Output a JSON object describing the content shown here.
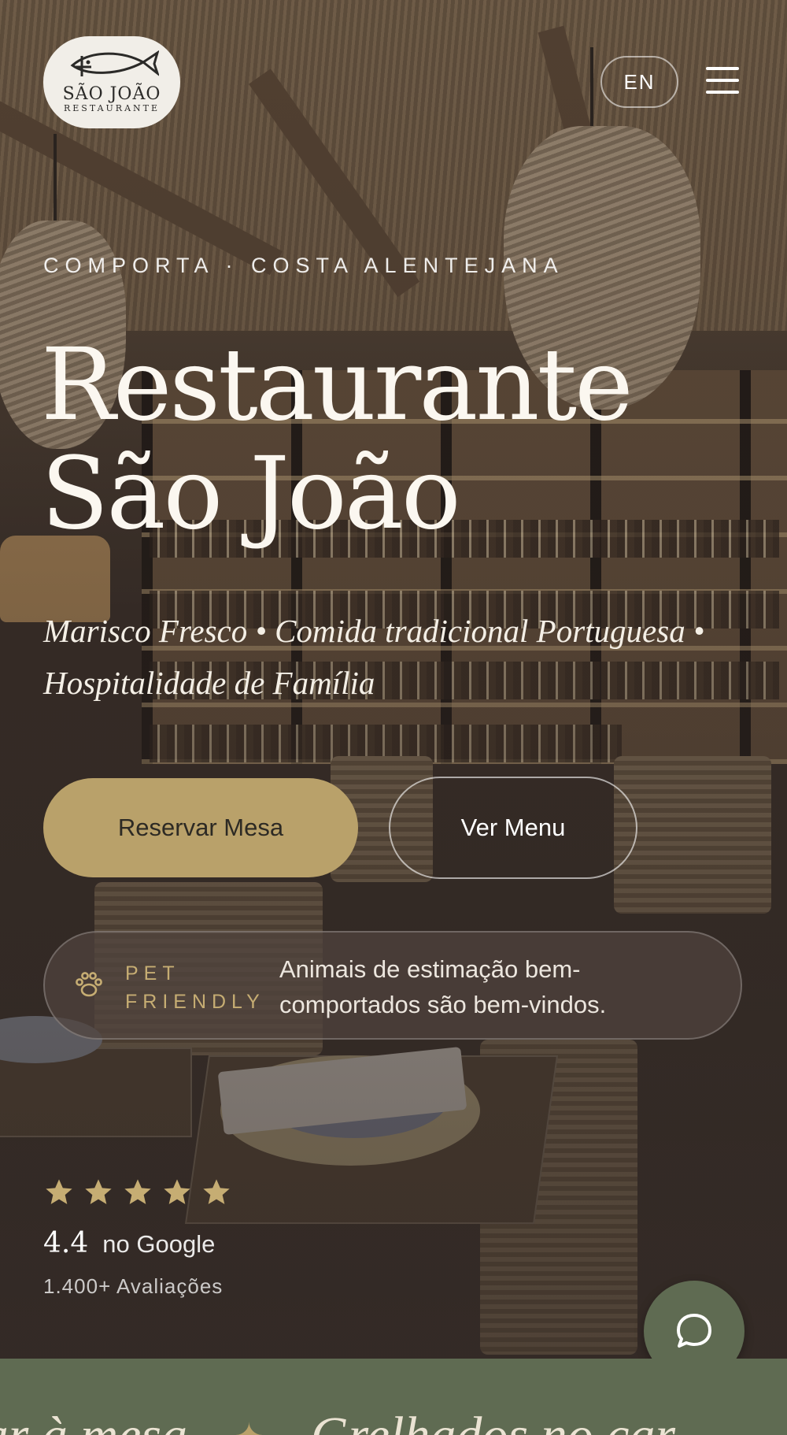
{
  "header": {
    "logo": {
      "brand_name": "SÃO JOÃO",
      "brand_sub": "RESTAURANTE"
    },
    "language_button": "EN",
    "menu_icon": "hamburger-menu-icon"
  },
  "hero": {
    "eyebrow": "COMPORTA · COSTA ALENTEJANA",
    "title_line_1": "Restaurante",
    "title_line_2": "São João",
    "tagline": "Marisco Fresco • Comida tradicional Portuguesa • Hospitalidade de Família",
    "primary_button": "Reservar Mesa",
    "secondary_button": "Ver Menu"
  },
  "pet_friendly": {
    "icon": "paw-icon",
    "label_line_1": "PET",
    "label_line_2": "FRIENDLY",
    "text": "Animais de estimação bem-comportados são bem-vindos."
  },
  "rating": {
    "stars": 5,
    "value": "4.4",
    "source": "no Google",
    "review_count": "1.400+ Avaliações"
  },
  "chat_button": {
    "icon": "chat-bubble-icon"
  },
  "marquee": {
    "items": [
      "mar à mesa",
      "Grelhados no car"
    ]
  },
  "colors": {
    "accent_gold": "#b9a16a",
    "band_green": "#5f6b52",
    "logo_bg": "#f1eee8"
  }
}
